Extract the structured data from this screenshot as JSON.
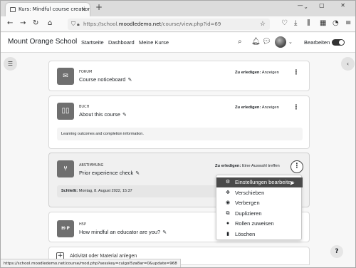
{
  "browser": {
    "tab_title": "Kurs: Mindful course creation",
    "tab_close": "✕",
    "new_tab": "+",
    "url_prefix": "https://school.",
    "url_host": "moodledemo.net",
    "url_path": "/course/view.php?id=69",
    "window_controls": "—  ▢  ✕"
  },
  "header": {
    "site_name": "Mount Orange School",
    "nav": [
      "Startseite",
      "Dashboard",
      "Meine Kurse"
    ],
    "edit_mode_label": "Bearbeiten"
  },
  "activities": [
    {
      "type": "FORUM",
      "icon_glyph": "✉",
      "name": "Course noticeboard",
      "todo_label": "Zu erledigen:",
      "todo_value": "Anzeigen"
    },
    {
      "type": "BUCH",
      "icon_glyph": "📖",
      "name": "About this course",
      "todo_label": "Zu erledigen:",
      "todo_value": "Anzeigen",
      "info": "Learning outcomes and completion information."
    },
    {
      "type": "ABSTIMMUNG",
      "icon_glyph": "⑂",
      "name": "Prior experience check",
      "todo_label": "Zu erledigen:",
      "todo_value": "Eine Auswahl treffen",
      "close_label": "Schließt:",
      "close_value": "Montag, 8. August 2022, 15:37"
    },
    {
      "type": "H5P",
      "icon_glyph": "H·P",
      "name": "How mindful an educator are you?"
    }
  ],
  "menu": {
    "items": [
      {
        "label": "Einstellungen bearbeiten",
        "icon": "gear-icon",
        "glyph": "⚙"
      },
      {
        "label": "Verschieben",
        "icon": "move-icon",
        "glyph": "✥"
      },
      {
        "label": "Verbergen",
        "icon": "eye-icon",
        "glyph": "◉"
      },
      {
        "label": "Duplizieren",
        "icon": "copy-icon",
        "glyph": "⧉"
      },
      {
        "label": "Rollen zuweisen",
        "icon": "user-icon",
        "glyph": "●"
      },
      {
        "label": "Löschen",
        "icon": "trash-icon",
        "glyph": "▮"
      }
    ]
  },
  "add_activity_label": "Aktivität oder Material anlegen",
  "status_url": "https://school.moodledemo.net/course/mod.php?sesskey=culgol5za8ar=0&update=968",
  "colors": {
    "menu_active_bg": "#4a4a4a",
    "module_icon_bg": "#6f6f6f"
  }
}
